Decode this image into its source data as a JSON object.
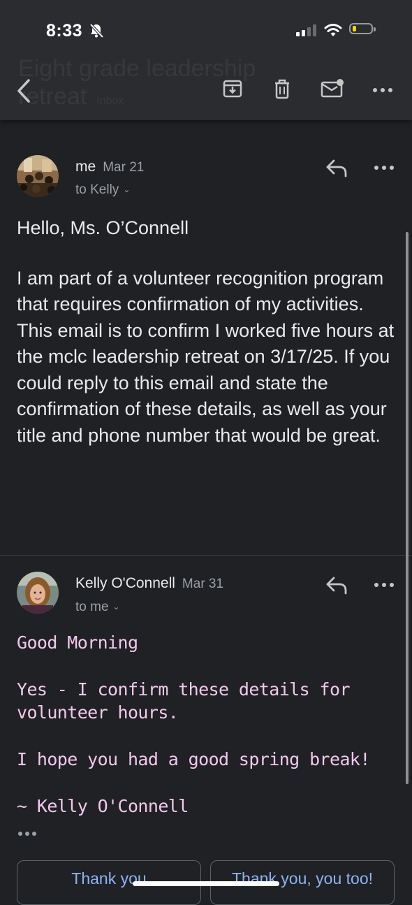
{
  "status_bar": {
    "time": "8:33",
    "signal_bars_active": 2,
    "battery_level_percent": 10,
    "icons": [
      "bell-slash-icon",
      "signal-icon",
      "wifi-icon",
      "battery-icon"
    ]
  },
  "toolbar": {
    "subject": "Eight grade leadership retreat",
    "label": "Inbox",
    "icons": [
      "back-arrow-icon",
      "archive-icon",
      "trash-icon",
      "mark-unread-icon",
      "more-horizontal-icon"
    ]
  },
  "messages": [
    {
      "sender": "me",
      "date": "Mar 21",
      "to": "to Kelly",
      "body": [
        "Hello, Ms. O’Connell",
        "I am part of a volunteer recognition program that requires confirmation of my activities. This email is to confirm I worked five hours at the mclc leadership retreat on 3/17/25. If you could reply to this email and state the confirmation of these details, as well as your title and phone number that would be great."
      ]
    },
    {
      "sender": "Kelly O'Connell",
      "date": "Mar 31",
      "to": "to me",
      "body": [
        "Good Morning",
        "Yes - I confirm these details for volunteer hours.",
        "I hope you had a good spring break!",
        "~ Kelly O'Connell"
      ]
    }
  ],
  "smart_replies": [
    "Thank you",
    "Thank you, you too!"
  ],
  "colors": {
    "background": "#202124",
    "toolbar": "#2b2c30",
    "reply_text": "#f4c7ee",
    "accent": "#8ab4f8"
  }
}
